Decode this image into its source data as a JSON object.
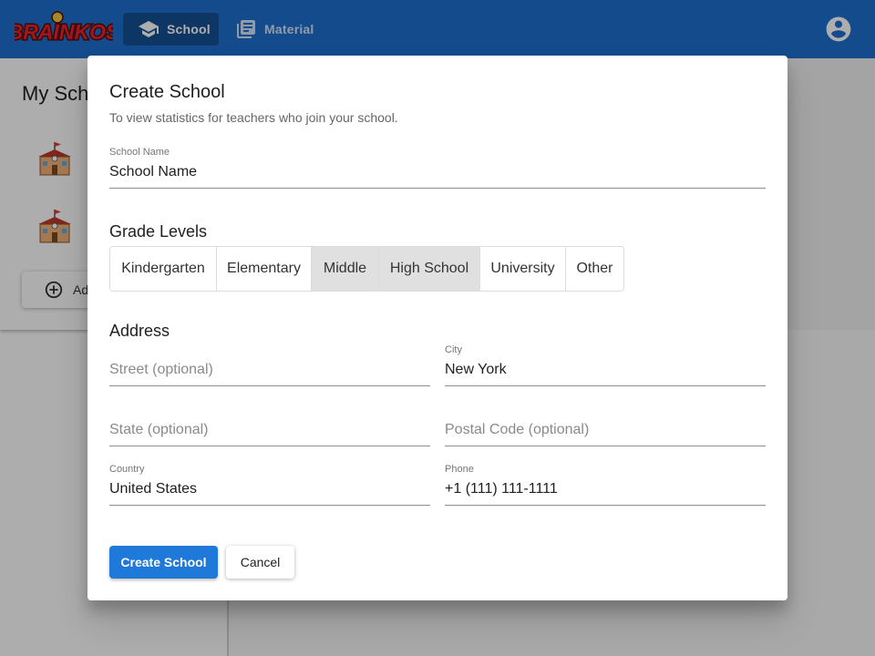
{
  "app": {
    "logo_text": "BRAINKOS",
    "nav": [
      {
        "label": "School",
        "icon": "school-icon",
        "active": true
      },
      {
        "label": "Material",
        "icon": "library-books-icon",
        "active": false
      }
    ],
    "account_icon": "account-circle-icon",
    "colors": {
      "appbar": "#1e6fd0",
      "primary": "#1f79d8"
    }
  },
  "page": {
    "title": "My Schools",
    "add_label": "Add School"
  },
  "dialog": {
    "title": "Create School",
    "subtitle": "To view statistics for teachers who join your school.",
    "school_name": {
      "label": "School Name",
      "value": "School Name"
    },
    "grade_levels": {
      "title": "Grade Levels",
      "options": [
        {
          "label": "Kindergarten",
          "selected": false
        },
        {
          "label": "Elementary",
          "selected": false
        },
        {
          "label": "Middle",
          "selected": true
        },
        {
          "label": "High School",
          "selected": true
        },
        {
          "label": "University",
          "selected": false
        },
        {
          "label": "Other",
          "selected": false
        }
      ]
    },
    "address": {
      "title": "Address",
      "street": {
        "label": "",
        "value": "",
        "placeholder": "Street (optional)"
      },
      "city": {
        "label": "City",
        "value": "New York"
      },
      "state": {
        "label": "",
        "value": "",
        "placeholder": "State (optional)"
      },
      "postal": {
        "label": "",
        "value": "",
        "placeholder": "Postal Code (optional)"
      },
      "country": {
        "label": "Country",
        "value": "United States"
      },
      "phone": {
        "label": "Phone",
        "value": "+1 (111) 111-1111"
      }
    },
    "create_button": "Create School",
    "cancel_button": "Cancel"
  }
}
